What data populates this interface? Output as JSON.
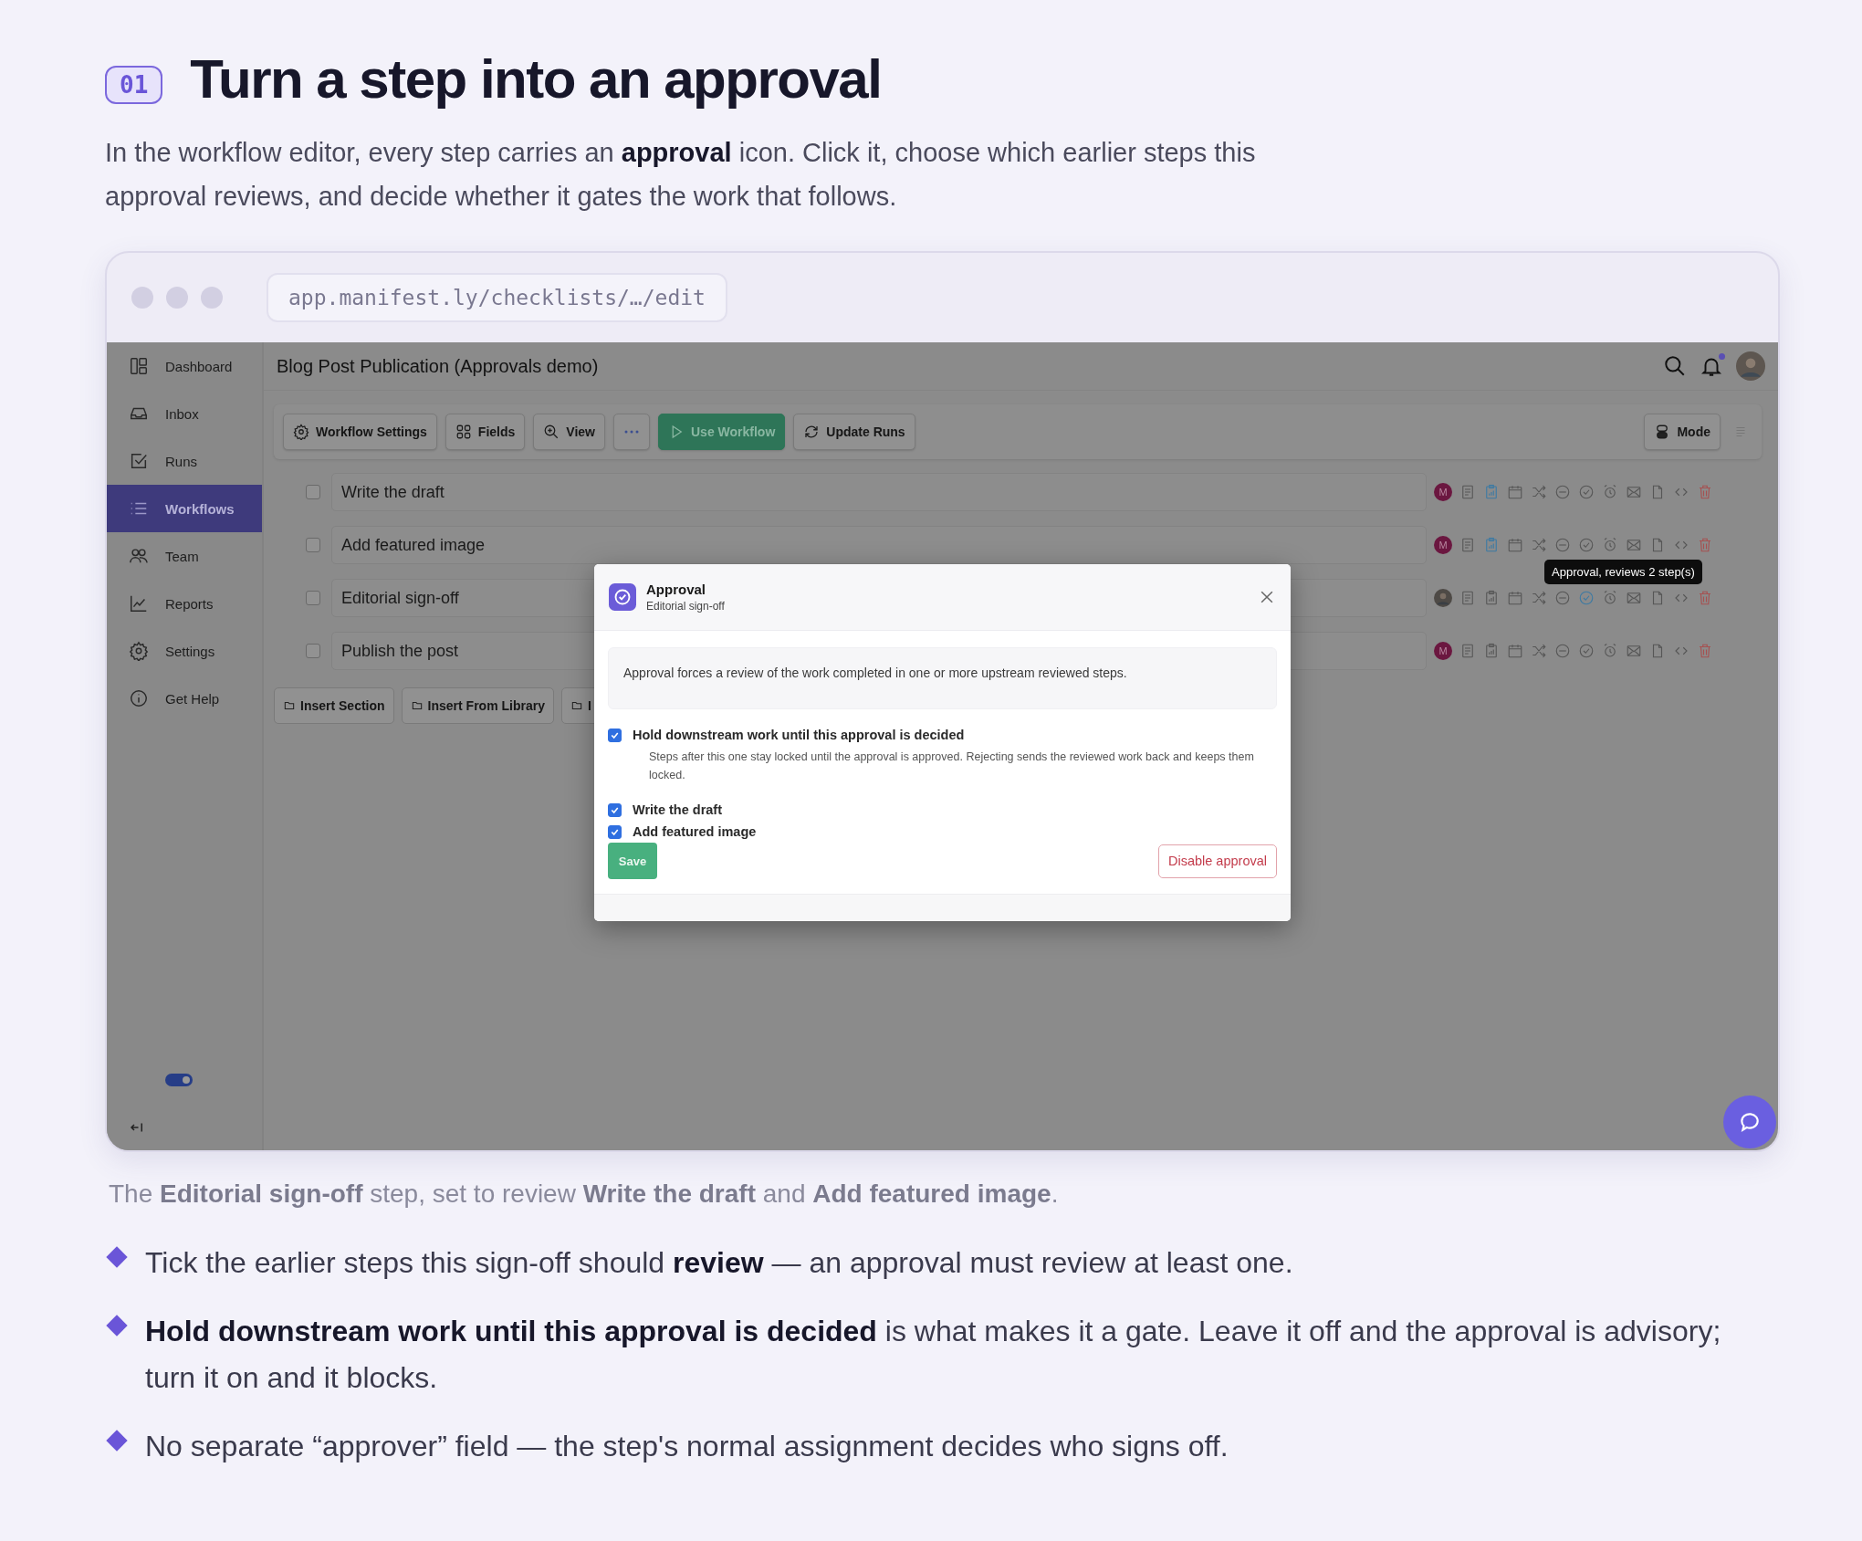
{
  "heading": {
    "badge": "01",
    "title": "Turn a step into an approval"
  },
  "intro": "In the workflow editor, every step carries an **approval** icon. Click it, choose which earlier steps this approval reviews, and decide whether it gates the work that follows.",
  "browser": {
    "url": "app.manifest.ly/checklists/…/edit"
  },
  "app": {
    "sidebar": {
      "items": [
        {
          "label": "Dashboard",
          "selected": false
        },
        {
          "label": "Inbox",
          "selected": false
        },
        {
          "label": "Runs",
          "selected": false
        },
        {
          "label": "Workflows",
          "selected": true
        },
        {
          "label": "Team",
          "selected": false
        },
        {
          "label": "Reports",
          "selected": false
        },
        {
          "label": "Settings",
          "selected": false
        },
        {
          "label": "Get Help",
          "selected": false
        }
      ],
      "toggle_on": true
    },
    "header": {
      "title": "Blog Post Publication (Approvals demo)",
      "notification": true
    },
    "toolbar": {
      "buttons": [
        {
          "kind": "default",
          "label": "Workflow Settings"
        },
        {
          "kind": "default",
          "label": "Fields"
        },
        {
          "kind": "default",
          "label": "View"
        },
        {
          "kind": "more"
        },
        {
          "kind": "primary",
          "label": "Use Workflow"
        },
        {
          "kind": "default",
          "label": "Update Runs"
        }
      ],
      "mode_button": "Mode"
    },
    "steps": [
      {
        "title": "Write the draft",
        "checked": false,
        "assignee": {
          "kind": "initial",
          "text": "M"
        },
        "clipboard_on": true,
        "approval_on": false
      },
      {
        "title": "Add featured image",
        "checked": false,
        "assignee": {
          "kind": "initial",
          "text": "M"
        },
        "clipboard_on": true,
        "approval_on": false
      },
      {
        "title": "Editorial sign-off",
        "checked": false,
        "assignee": {
          "kind": "photo"
        },
        "clipboard_on": false,
        "approval_on": true
      },
      {
        "title": "Publish the post",
        "checked": false,
        "assignee": {
          "kind": "initial",
          "text": "M"
        },
        "clipboard_on": false,
        "approval_on": false
      }
    ],
    "tooltip": "Approval, reviews 2 step(s)",
    "insert_buttons": [
      "Insert Section",
      "Insert From Library",
      "I"
    ],
    "modal": {
      "title": "Approval",
      "subtitle": "Editorial sign-off",
      "info": "Approval forces a review of the work completed in one or more upstream reviewed steps.",
      "hold": {
        "label": "Hold downstream work until this approval is decided",
        "checked": true,
        "help": "Steps after this one stay locked until the approval is approved. Rejecting sends the reviewed work back and keeps them locked."
      },
      "reviewed_steps": [
        {
          "label": "Write the draft",
          "checked": true
        },
        {
          "label": "Add featured image",
          "checked": true
        }
      ],
      "save": "Save",
      "disable": "Disable approval"
    }
  },
  "caption": "The **Editorial sign-off** step, set to review **Write the draft** and **Add featured image**.",
  "bullets": [
    "Tick the earlier steps this sign-off should **review** — an approval must review at least one.",
    "**Hold downstream work until this approval is decided** is what makes it a gate. Leave it off and the approval is advisory; turn it on and it blocks.",
    "No separate “approver” field — the step's normal assignment decides who signs off."
  ]
}
